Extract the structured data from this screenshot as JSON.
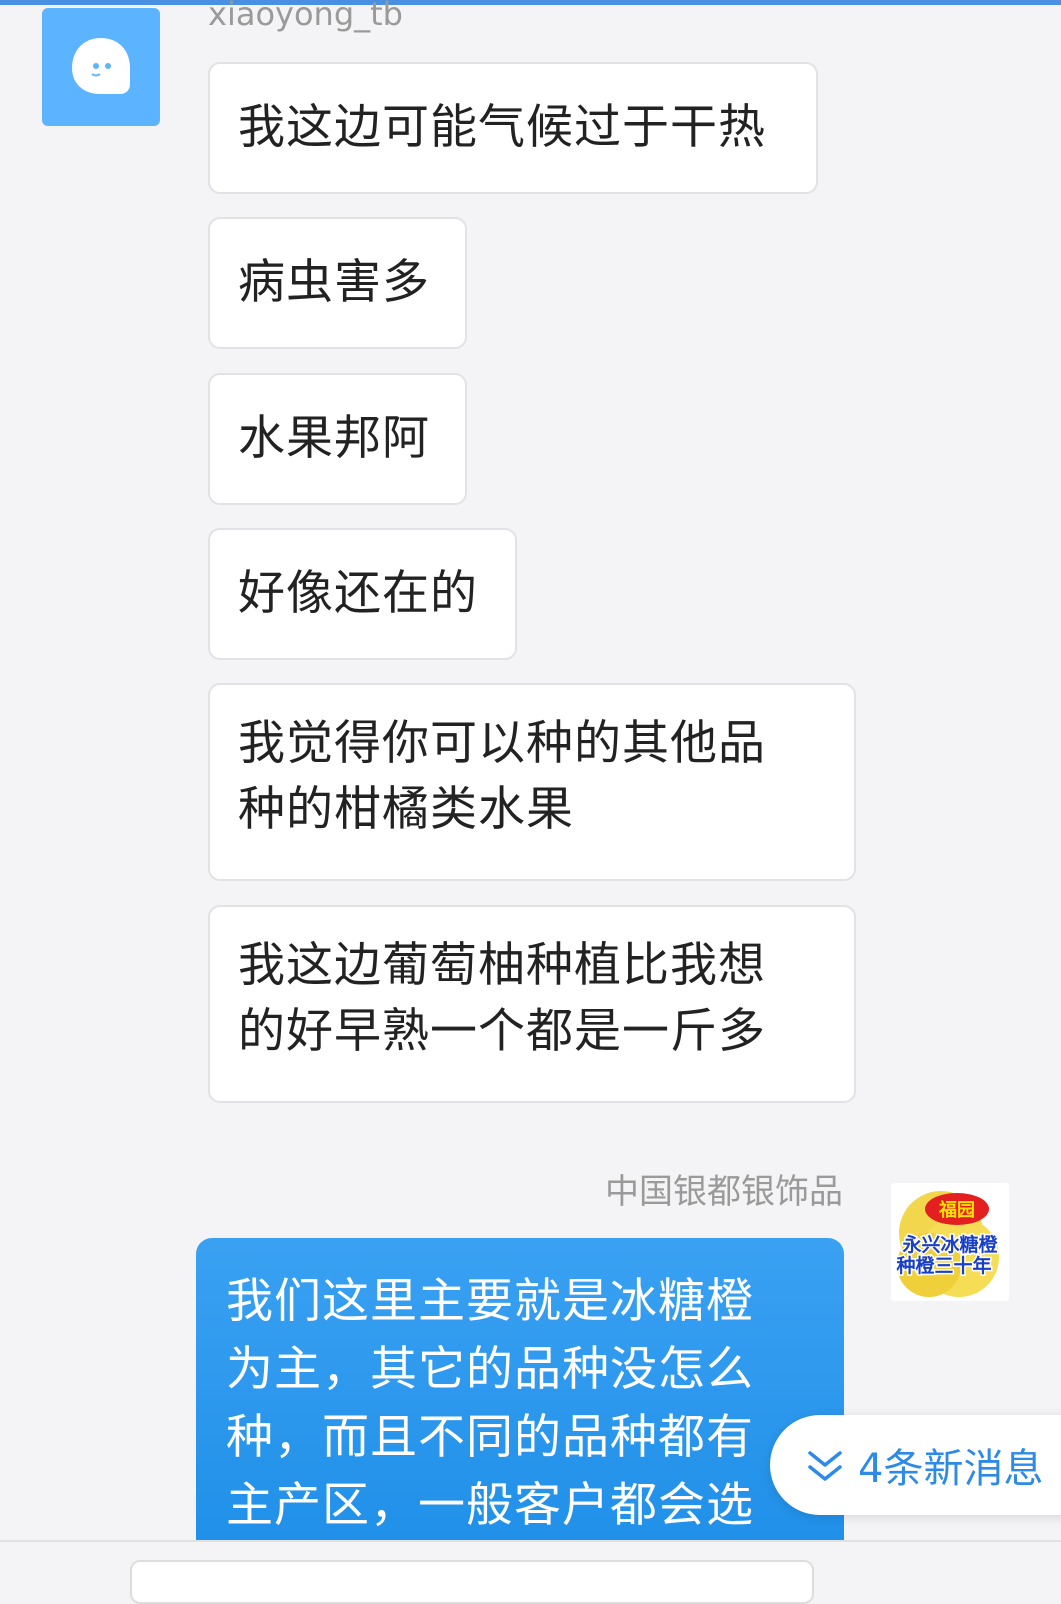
{
  "left_user": {
    "name": "xiaoyong_tb",
    "avatar_icon": "qq-penguin-bubble-icon",
    "avatar_color": "#5cb3ff"
  },
  "left_messages": [
    "我这边可能气候过于干热",
    "病虫害多",
    "水果邦阿",
    "好像还在的",
    "我觉得你可以种的其他品\n种的柑橘类水果",
    "我这边葡萄柚种植比我想\n的好早熟一个都是一斤多"
  ],
  "right_user": {
    "name": "中国银都银饰品",
    "avatar": {
      "top_text": "福园",
      "line1": "永兴冰糖橙",
      "line2": "种橙三十年"
    }
  },
  "right_message": "我们这里主要就是冰糖橙\n为主，其它的品种没怎么\n种，而且不同的品种都有\n主产区，一般客户都会选",
  "new_messages": {
    "label": "4条新消息",
    "icon": "double-chevron-down-icon"
  },
  "colors": {
    "accent": "#2d8ae6",
    "bubble_right": "#1f8fe8",
    "bubble_left": "#ffffff"
  }
}
